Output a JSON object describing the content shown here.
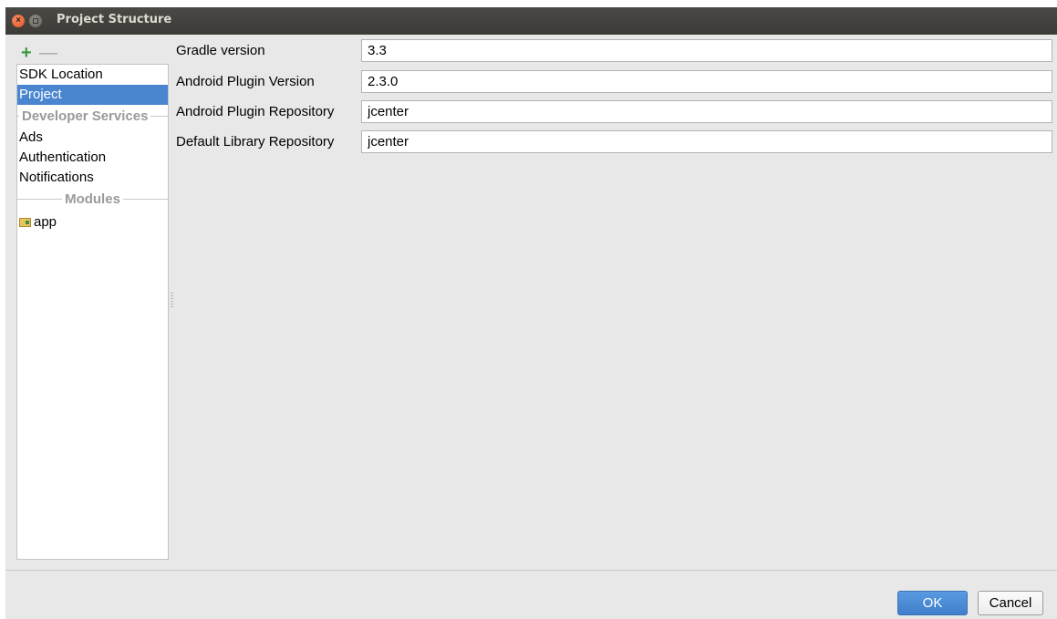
{
  "window": {
    "title": "Project Structure",
    "close_icon": "close-icon",
    "minimize_icon": "minimize-icon"
  },
  "toolbar": {
    "add_symbol": "+",
    "remove_symbol": "—"
  },
  "sidebar": {
    "sdk_location": "SDK Location",
    "project": "Project",
    "developer_services_header": "Developer Services",
    "ads": "Ads",
    "authentication": "Authentication",
    "notifications": "Notifications",
    "modules_header": "Modules",
    "module_app": "app",
    "selected": "Project"
  },
  "form": {
    "gradle_version_label": "Gradle version",
    "gradle_version_value": "3.3",
    "android_plugin_version_label": "Android Plugin Version",
    "android_plugin_version_value": "2.3.0",
    "android_plugin_repository_label": "Android Plugin Repository",
    "android_plugin_repository_value": "jcenter",
    "default_library_repository_label": "Default Library Repository",
    "default_library_repository_value": "jcenter"
  },
  "buttons": {
    "ok": "OK",
    "cancel": "Cancel"
  },
  "colors": {
    "accent": "#4a86cf",
    "add_green": "#3d9a3d",
    "titlebar": "#3c3b37"
  }
}
